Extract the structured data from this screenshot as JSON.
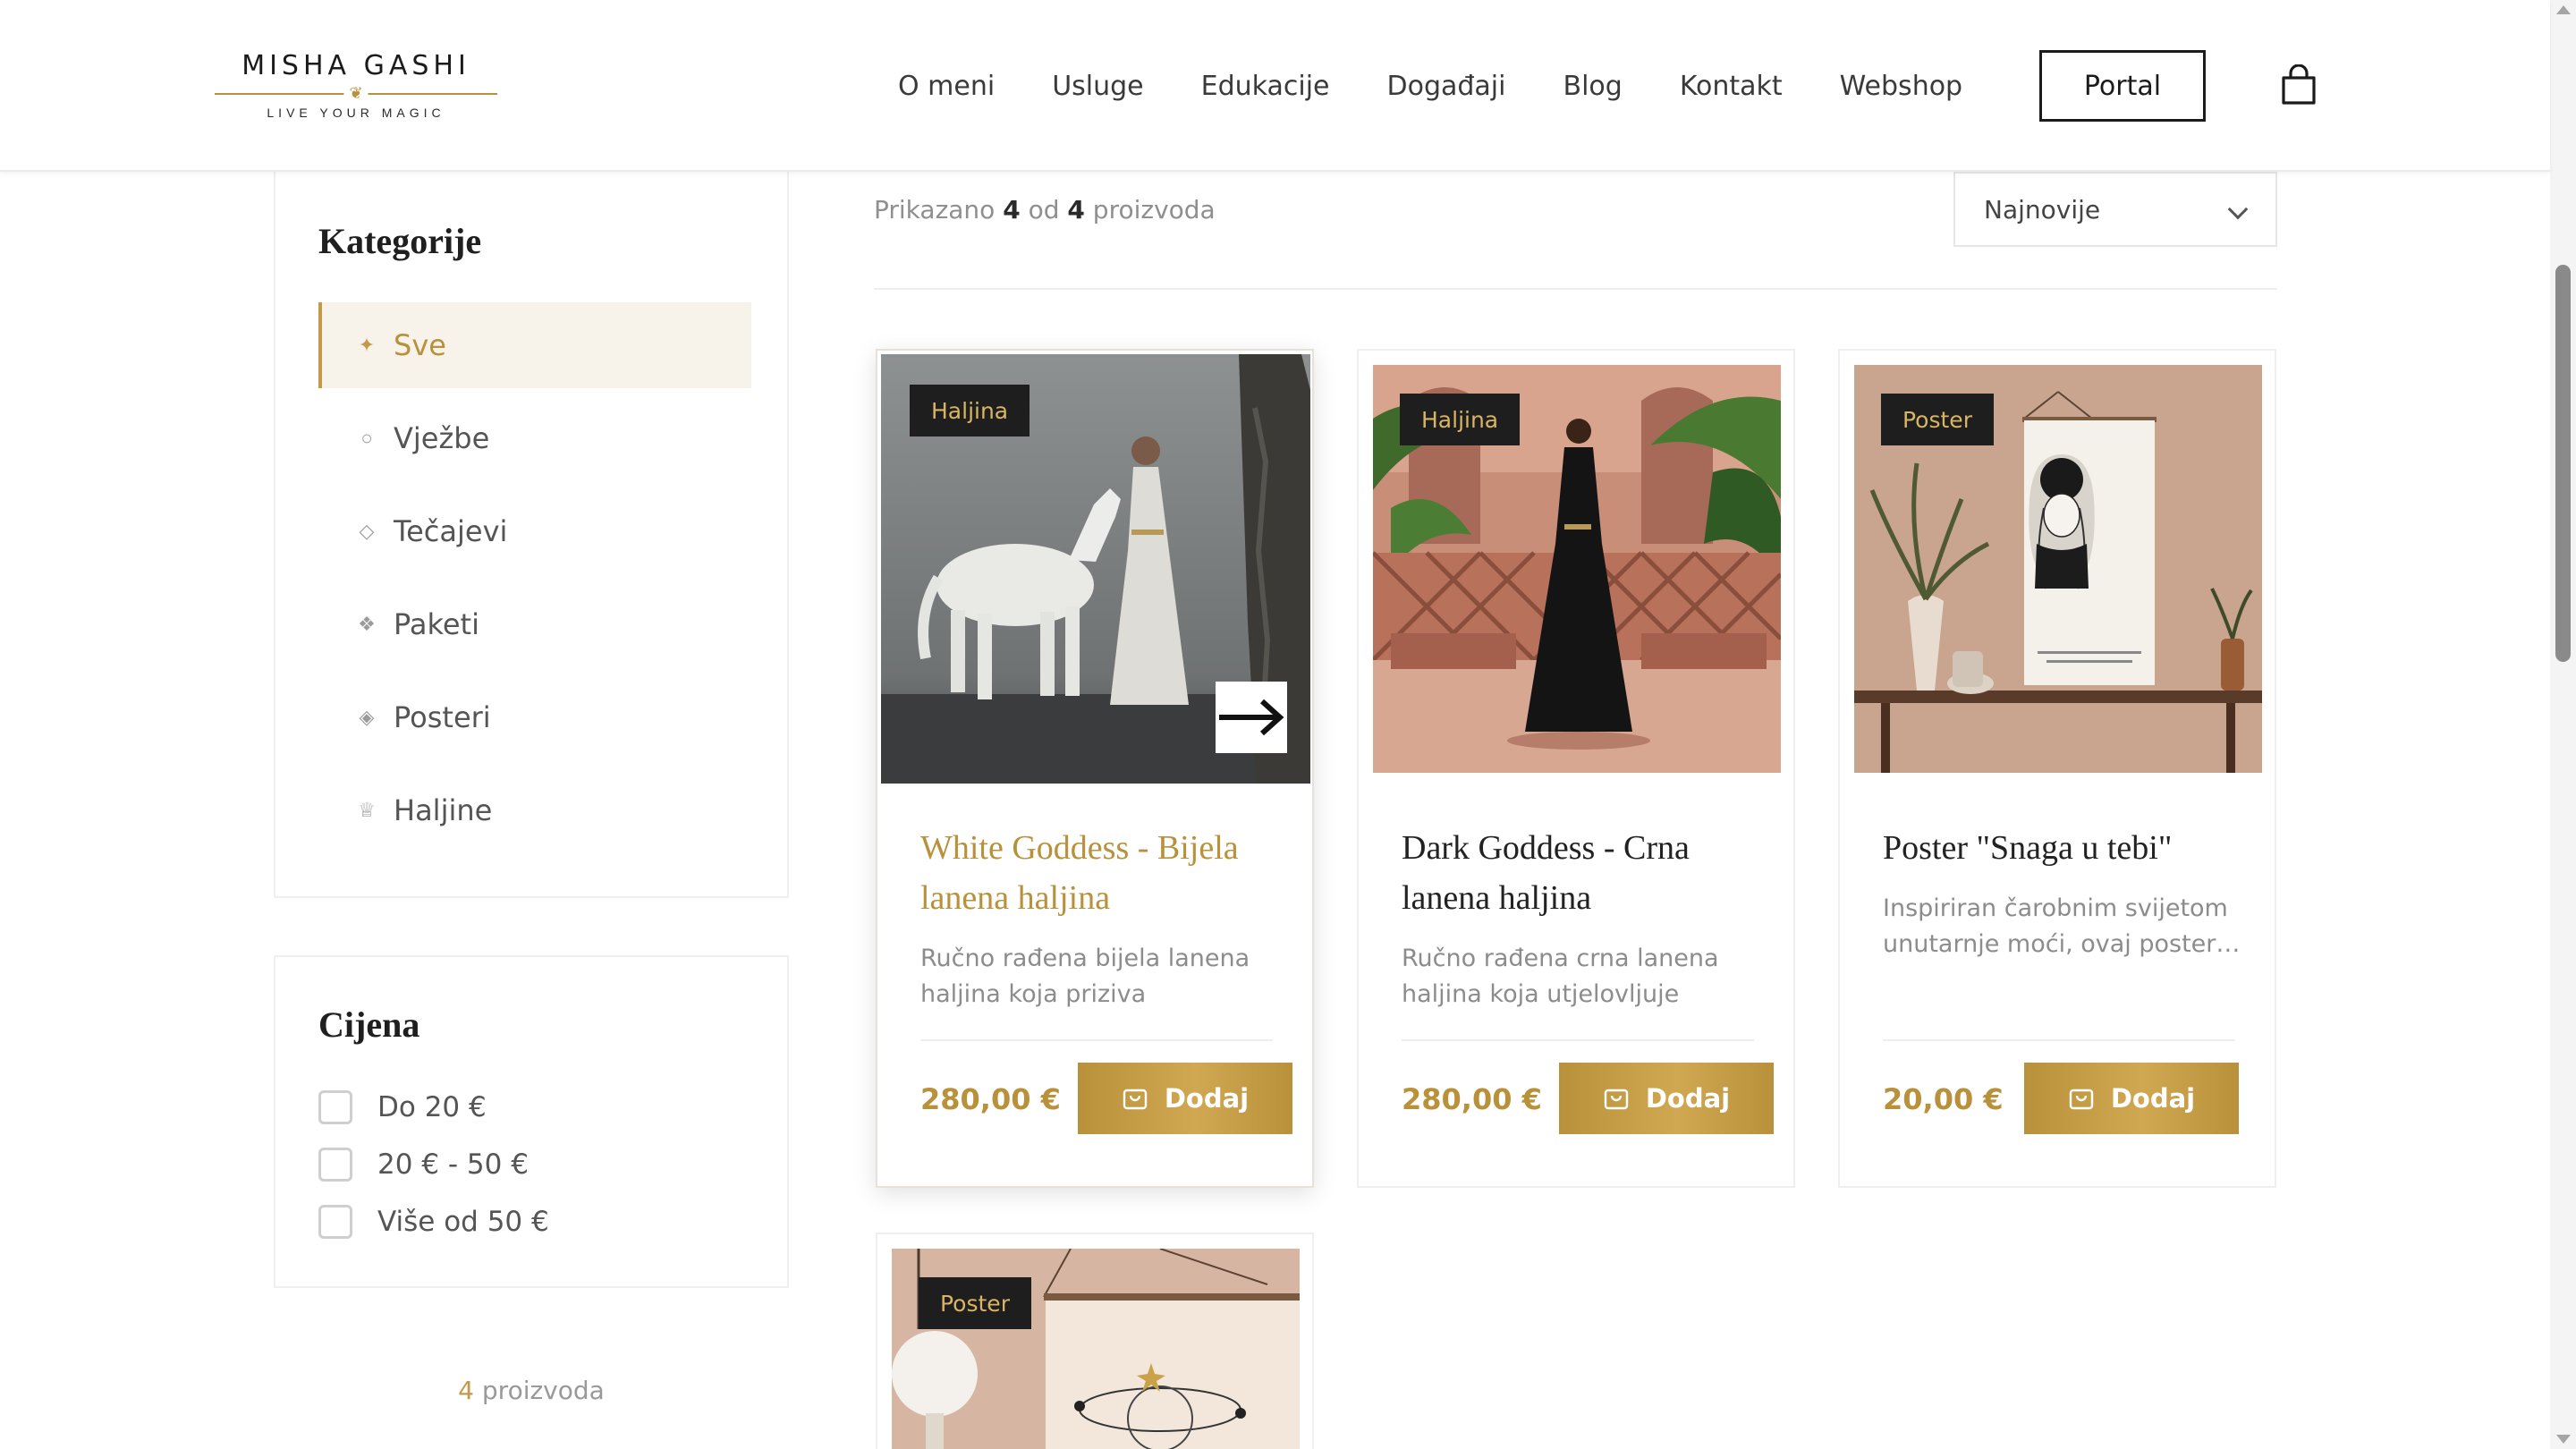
{
  "header": {
    "logo_name": "MISHA GASHI",
    "logo_tagline": "LIVE YOUR MAGIC",
    "nav": [
      "O meni",
      "Usluge",
      "Edukacije",
      "Događaji",
      "Blog",
      "Kontakt",
      "Webshop"
    ],
    "portal_label": "Portal"
  },
  "sidebar": {
    "categories_title": "Kategorije",
    "categories": [
      {
        "label": "Sve",
        "icon": "sparkle-icon",
        "active": true
      },
      {
        "label": "Vježbe",
        "icon": "circle-icon"
      },
      {
        "label": "Tečajevi",
        "icon": "diamond-icon"
      },
      {
        "label": "Paketi",
        "icon": "four-diamonds-icon"
      },
      {
        "label": "Posteri",
        "icon": "diamond-dot-icon"
      },
      {
        "label": "Haljine",
        "icon": "crown-icon"
      }
    ],
    "price_title": "Cijena",
    "price_options": [
      "Do 20 €",
      "20 € - 50 €",
      "Više od 50 €"
    ],
    "count_number": "4",
    "count_label": "proizvoda"
  },
  "toolbar": {
    "shown_prefix": "Prikazano",
    "shown_count": "4",
    "shown_of": "od",
    "shown_total": "4",
    "shown_suffix": "proizvoda",
    "sort_value": "Najnovije"
  },
  "products": [
    {
      "badge": "Haljina",
      "title": "White Goddess - Bijela lanena haljina",
      "description": "Ručno rađena bijela lanena haljina koja priziva arhetipove…",
      "price": "280,00 €",
      "add_label": "Dodaj"
    },
    {
      "badge": "Haljina",
      "title": "Dark Goddess - Crna lanena haljina",
      "description": "Ručno rađena crna lanena haljina koja utjelovljuje arheti…",
      "price": "280,00 €",
      "add_label": "Dodaj"
    },
    {
      "badge": "Poster",
      "title": "Poster \"Snaga u tebi\"",
      "description": "Inspiriran čarobnim svijetom unutarnje moći, ovaj poster…",
      "price": "20,00 €",
      "add_label": "Dodaj"
    },
    {
      "badge": "Poster"
    }
  ],
  "colors": {
    "accent_gold": "#b8913a",
    "badge_bg": "#1e1e1e",
    "active_category_bg": "#f7f2ea"
  }
}
